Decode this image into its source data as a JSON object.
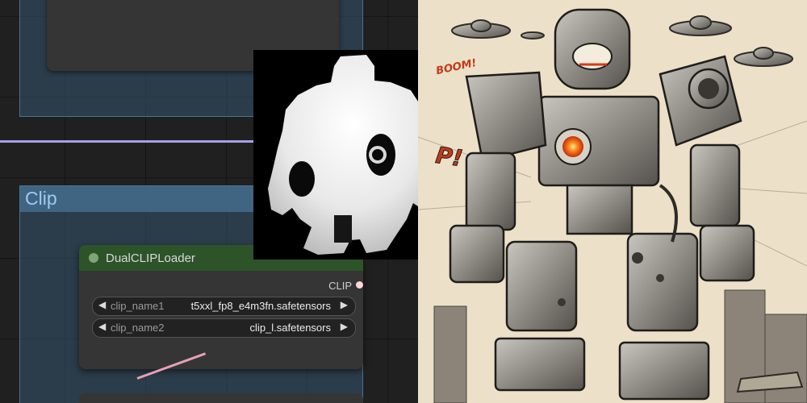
{
  "groups": {
    "clip": {
      "title": "Clip"
    }
  },
  "node": {
    "title": "DualCLIPLoader",
    "output": "CLIP",
    "widgets": [
      {
        "name": "clip_name1",
        "value": "t5xxl_fp8_e4m3fn.safetensors"
      },
      {
        "name": "clip_name2",
        "value": "clip_l.safetensors"
      }
    ],
    "arrows": {
      "left": "◀",
      "right": "▶"
    }
  },
  "comic": {
    "sfx_boom": "BOOM!",
    "sfx_partial": "P!"
  },
  "colors": {
    "group_fill": "#34536e",
    "group_title": "#9ecbf0",
    "node_header": "#2d5429",
    "link_purple": "#a6a1e8",
    "link_pink": "#e8a0b4",
    "reactor_core": "#ff5a1f"
  }
}
